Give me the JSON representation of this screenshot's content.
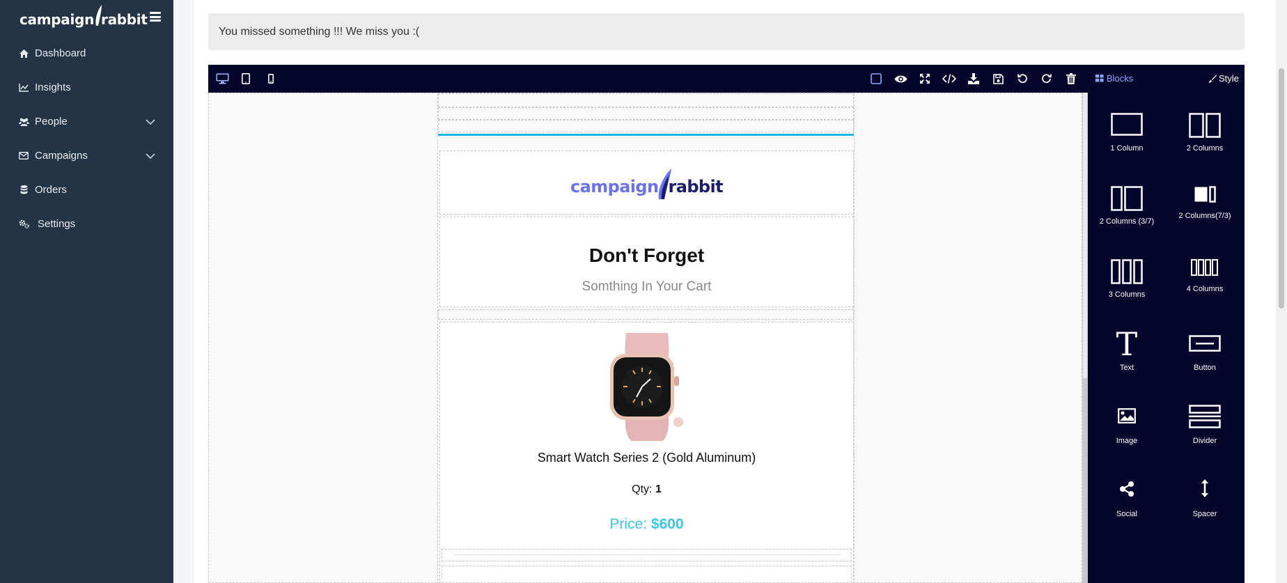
{
  "sidebar": {
    "brand": "campaign rabbit",
    "brand_left": "campaign",
    "brand_right": "rabbit",
    "items": [
      {
        "label": "Dashboard",
        "icon": "home-icon",
        "has_chevron": false
      },
      {
        "label": "Insights",
        "icon": "line-chart-icon",
        "has_chevron": false
      },
      {
        "label": "People",
        "icon": "users-icon",
        "has_chevron": true
      },
      {
        "label": "Campaigns",
        "icon": "envelope-icon",
        "has_chevron": true
      },
      {
        "label": "Orders",
        "icon": "database-icon",
        "has_chevron": false
      },
      {
        "label": "Settings",
        "icon": "cogs-icon",
        "has_chevron": false
      }
    ]
  },
  "alert": {
    "text": "You missed something !!! We miss you :("
  },
  "toolbar": {
    "device_icons": [
      "desktop-icon",
      "tablet-icon",
      "mobile-icon"
    ],
    "action_icons": [
      "outline-icon",
      "preview-icon",
      "fullscreen-icon",
      "code-icon",
      "download-icon",
      "save-icon",
      "undo-icon",
      "redo-icon",
      "trash-icon"
    ],
    "blocks_label": "Blocks",
    "style_label": "Style"
  },
  "email": {
    "logo_left": "campaign",
    "logo_right": "rabbit",
    "title": "Don't Forget",
    "subtitle": "Somthing In Your Cart",
    "product_name": "Smart Watch Series 2 (Gold Aluminum)",
    "qty_label": "Qty:",
    "qty_value": "1",
    "price_label": "Price:",
    "price_value": "$600"
  },
  "blocks": [
    {
      "label": "1 Column",
      "icon": "one-column-icon"
    },
    {
      "label": "2 Columns",
      "icon": "two-columns-icon"
    },
    {
      "label": "2 Columns (3/7)",
      "icon": "two-columns-37-icon"
    },
    {
      "label": "2 Columns(7/3)",
      "icon": "two-columns-73-icon"
    },
    {
      "label": "3 Columns",
      "icon": "three-columns-icon"
    },
    {
      "label": "4 Columns",
      "icon": "four-columns-icon"
    },
    {
      "label": "Text",
      "icon": "text-icon"
    },
    {
      "label": "Button",
      "icon": "button-icon"
    },
    {
      "label": "Image",
      "icon": "image-icon"
    },
    {
      "label": "Divider",
      "icon": "divider-icon"
    },
    {
      "label": "Social",
      "icon": "share-icon"
    },
    {
      "label": "Spacer",
      "icon": "spacer-icon"
    }
  ],
  "colors": {
    "sidebar_bg": "#243447",
    "toolbar_bg": "#04052b",
    "accent": "#1fb5e5",
    "price": "#3cc6e8",
    "blocks_link": "#8da7ff"
  }
}
